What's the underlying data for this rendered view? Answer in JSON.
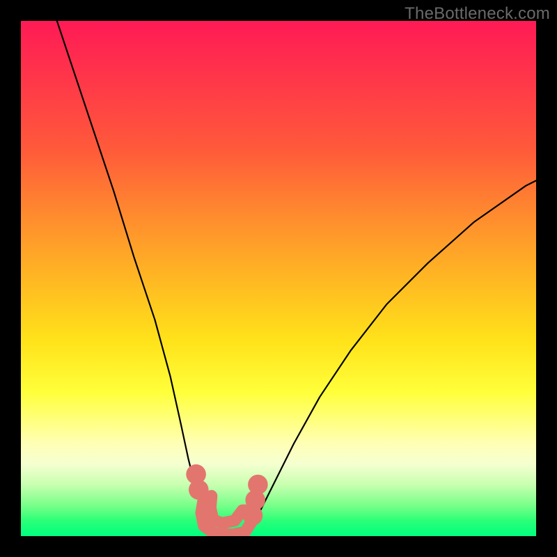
{
  "watermark": "TheBottleneck.com",
  "chart_data": {
    "type": "line",
    "title": "",
    "xlabel": "",
    "ylabel": "",
    "xlim": [
      0,
      100
    ],
    "ylim": [
      0,
      100
    ],
    "grid": false,
    "legend": false,
    "background": {
      "type": "vertical-gradient",
      "stops": [
        {
          "pct": 0,
          "color": "#ff1a55"
        },
        {
          "pct": 25,
          "color": "#ff5a3a"
        },
        {
          "pct": 50,
          "color": "#ffb723"
        },
        {
          "pct": 72,
          "color": "#ffff3a"
        },
        {
          "pct": 86,
          "color": "#f5ffd0"
        },
        {
          "pct": 100,
          "color": "#00ff7f"
        }
      ]
    },
    "series": [
      {
        "name": "left-curve",
        "stroke": "#000000",
        "x": [
          7,
          10,
          14,
          18,
          22,
          26,
          29,
          31,
          32.5,
          34,
          35.5,
          37
        ],
        "values": [
          100,
          91,
          79,
          67,
          54,
          42,
          31,
          22,
          15,
          9,
          4,
          0
        ]
      },
      {
        "name": "right-curve",
        "stroke": "#000000",
        "x": [
          44,
          46,
          49,
          53,
          58,
          64,
          71,
          79,
          88,
          98,
          100
        ],
        "values": [
          0,
          4,
          10,
          18,
          27,
          36,
          45,
          53,
          61,
          68,
          69
        ]
      },
      {
        "name": "valley-floor",
        "stroke": "#000000",
        "x": [
          37,
          40.5,
          44
        ],
        "values": [
          0,
          0,
          0
        ]
      }
    ],
    "markers": [
      {
        "name": "left-dot-upper",
        "x": 34.0,
        "y": 12,
        "r": 1.6,
        "color": "#e3756f"
      },
      {
        "name": "left-dot-lower",
        "x": 34.5,
        "y": 9,
        "r": 1.6,
        "color": "#e3756f"
      },
      {
        "name": "right-dot-upper",
        "x": 46.0,
        "y": 10,
        "r": 1.6,
        "color": "#e3756f"
      },
      {
        "name": "right-dot-mid",
        "x": 45.5,
        "y": 7,
        "r": 1.6,
        "color": "#e3756f"
      },
      {
        "name": "right-dot-lower",
        "x": 45.0,
        "y": 4,
        "r": 1.6,
        "color": "#e3756f"
      }
    ],
    "valley_blob": {
      "color": "#e3756f",
      "path_xy": [
        [
          35.5,
          7.5
        ],
        [
          35.0,
          4.5
        ],
        [
          35.5,
          2.0
        ],
        [
          37.5,
          0.5
        ],
        [
          41.0,
          0.3
        ],
        [
          43.5,
          0.8
        ],
        [
          44.8,
          2.8
        ],
        [
          44.8,
          5.0
        ],
        [
          43.0,
          5.0
        ],
        [
          41.5,
          3.0
        ],
        [
          39.0,
          2.5
        ],
        [
          37.3,
          3.2
        ],
        [
          36.8,
          5.5
        ],
        [
          37.0,
          7.8
        ]
      ]
    }
  }
}
